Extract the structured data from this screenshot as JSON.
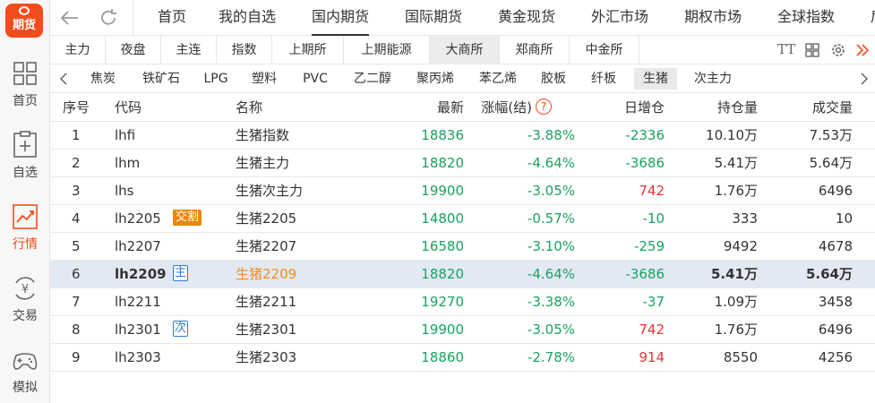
{
  "app": {
    "logo_text": "期货"
  },
  "sidebar": {
    "items": [
      {
        "label": "首页",
        "icon": "grid-icon"
      },
      {
        "label": "自选",
        "icon": "watchlist-icon"
      },
      {
        "label": "行情",
        "icon": "chart-icon",
        "active": true
      },
      {
        "label": "交易",
        "icon": "yuan-exchange-icon"
      },
      {
        "label": "模拟",
        "icon": "gamepad-icon"
      }
    ]
  },
  "topnav": {
    "tabs": [
      "首页",
      "我的自选",
      "国内期货",
      "国际期货",
      "黄金现货",
      "外汇市场",
      "期权市场",
      "全球指数",
      "后"
    ],
    "active": "国内期货"
  },
  "subtabs": {
    "items": [
      "主力",
      "夜盘",
      "主连",
      "指数",
      "上期所",
      "上期能源",
      "大商所",
      "郑商所",
      "中金所"
    ],
    "active": "大商所",
    "tools": {
      "font_icon": "TT"
    }
  },
  "varieties": {
    "items": [
      "焦炭",
      "铁矿石",
      "LPG",
      "塑料",
      "PVC",
      "乙二醇",
      "聚丙烯",
      "苯乙烯",
      "胶板",
      "纤板",
      "生猪",
      "次主力"
    ],
    "active": "生猪"
  },
  "table": {
    "headers": {
      "index": "序号",
      "code": "代码",
      "name": "名称",
      "last": "最新",
      "change": "涨幅(结)",
      "help": "?",
      "daily_oi": "日增仓",
      "oi": "持仓量",
      "volume": "成交量"
    },
    "rows": [
      {
        "index": "1",
        "code": "lhfi",
        "tag": "",
        "name": "生猪指数",
        "last": "18836",
        "change": "-3.88%",
        "daily_oi": "-2336",
        "oi": "10.10万",
        "volume": "7.53万"
      },
      {
        "index": "2",
        "code": "lhm",
        "tag": "",
        "name": "生猪主力",
        "last": "18820",
        "change": "-4.64%",
        "daily_oi": "-3686",
        "oi": "5.41万",
        "volume": "5.64万"
      },
      {
        "index": "3",
        "code": "lhs",
        "tag": "",
        "name": "生猪次主力",
        "last": "19900",
        "change": "-3.05%",
        "daily_oi": "742",
        "oi": "1.76万",
        "volume": "6496"
      },
      {
        "index": "4",
        "code": "lh2205",
        "tag": "交割",
        "name": "生猪2205",
        "last": "14800",
        "change": "-0.57%",
        "daily_oi": "-10",
        "oi": "333",
        "volume": "10"
      },
      {
        "index": "5",
        "code": "lh2207",
        "tag": "",
        "name": "生猪2207",
        "last": "16580",
        "change": "-3.10%",
        "daily_oi": "-259",
        "oi": "9492",
        "volume": "4678"
      },
      {
        "index": "6",
        "code": "lh2209",
        "tag": "主",
        "name": "生猪2209",
        "last": "18820",
        "change": "-4.64%",
        "daily_oi": "-3686",
        "oi": "5.41万",
        "volume": "5.64万"
      },
      {
        "index": "7",
        "code": "lh2211",
        "tag": "",
        "name": "生猪2211",
        "last": "19270",
        "change": "-3.38%",
        "daily_oi": "-37",
        "oi": "1.09万",
        "volume": "3458"
      },
      {
        "index": "8",
        "code": "lh2301",
        "tag": "次",
        "name": "生猪2301",
        "last": "19900",
        "change": "-3.05%",
        "daily_oi": "742",
        "oi": "1.76万",
        "volume": "6496"
      },
      {
        "index": "9",
        "code": "lh2303",
        "tag": "",
        "name": "生猪2303",
        "last": "18860",
        "change": "-2.78%",
        "daily_oi": "914",
        "oi": "8550",
        "volume": "4256"
      }
    ],
    "selected_index": "6"
  },
  "colors": {
    "accent": "#f24c1c",
    "up": "#e53535",
    "down": "#1aa260",
    "selected_row": "#e3e9f3",
    "tag_settle": "#e8870d",
    "tag_main": "#2a7bd4"
  }
}
